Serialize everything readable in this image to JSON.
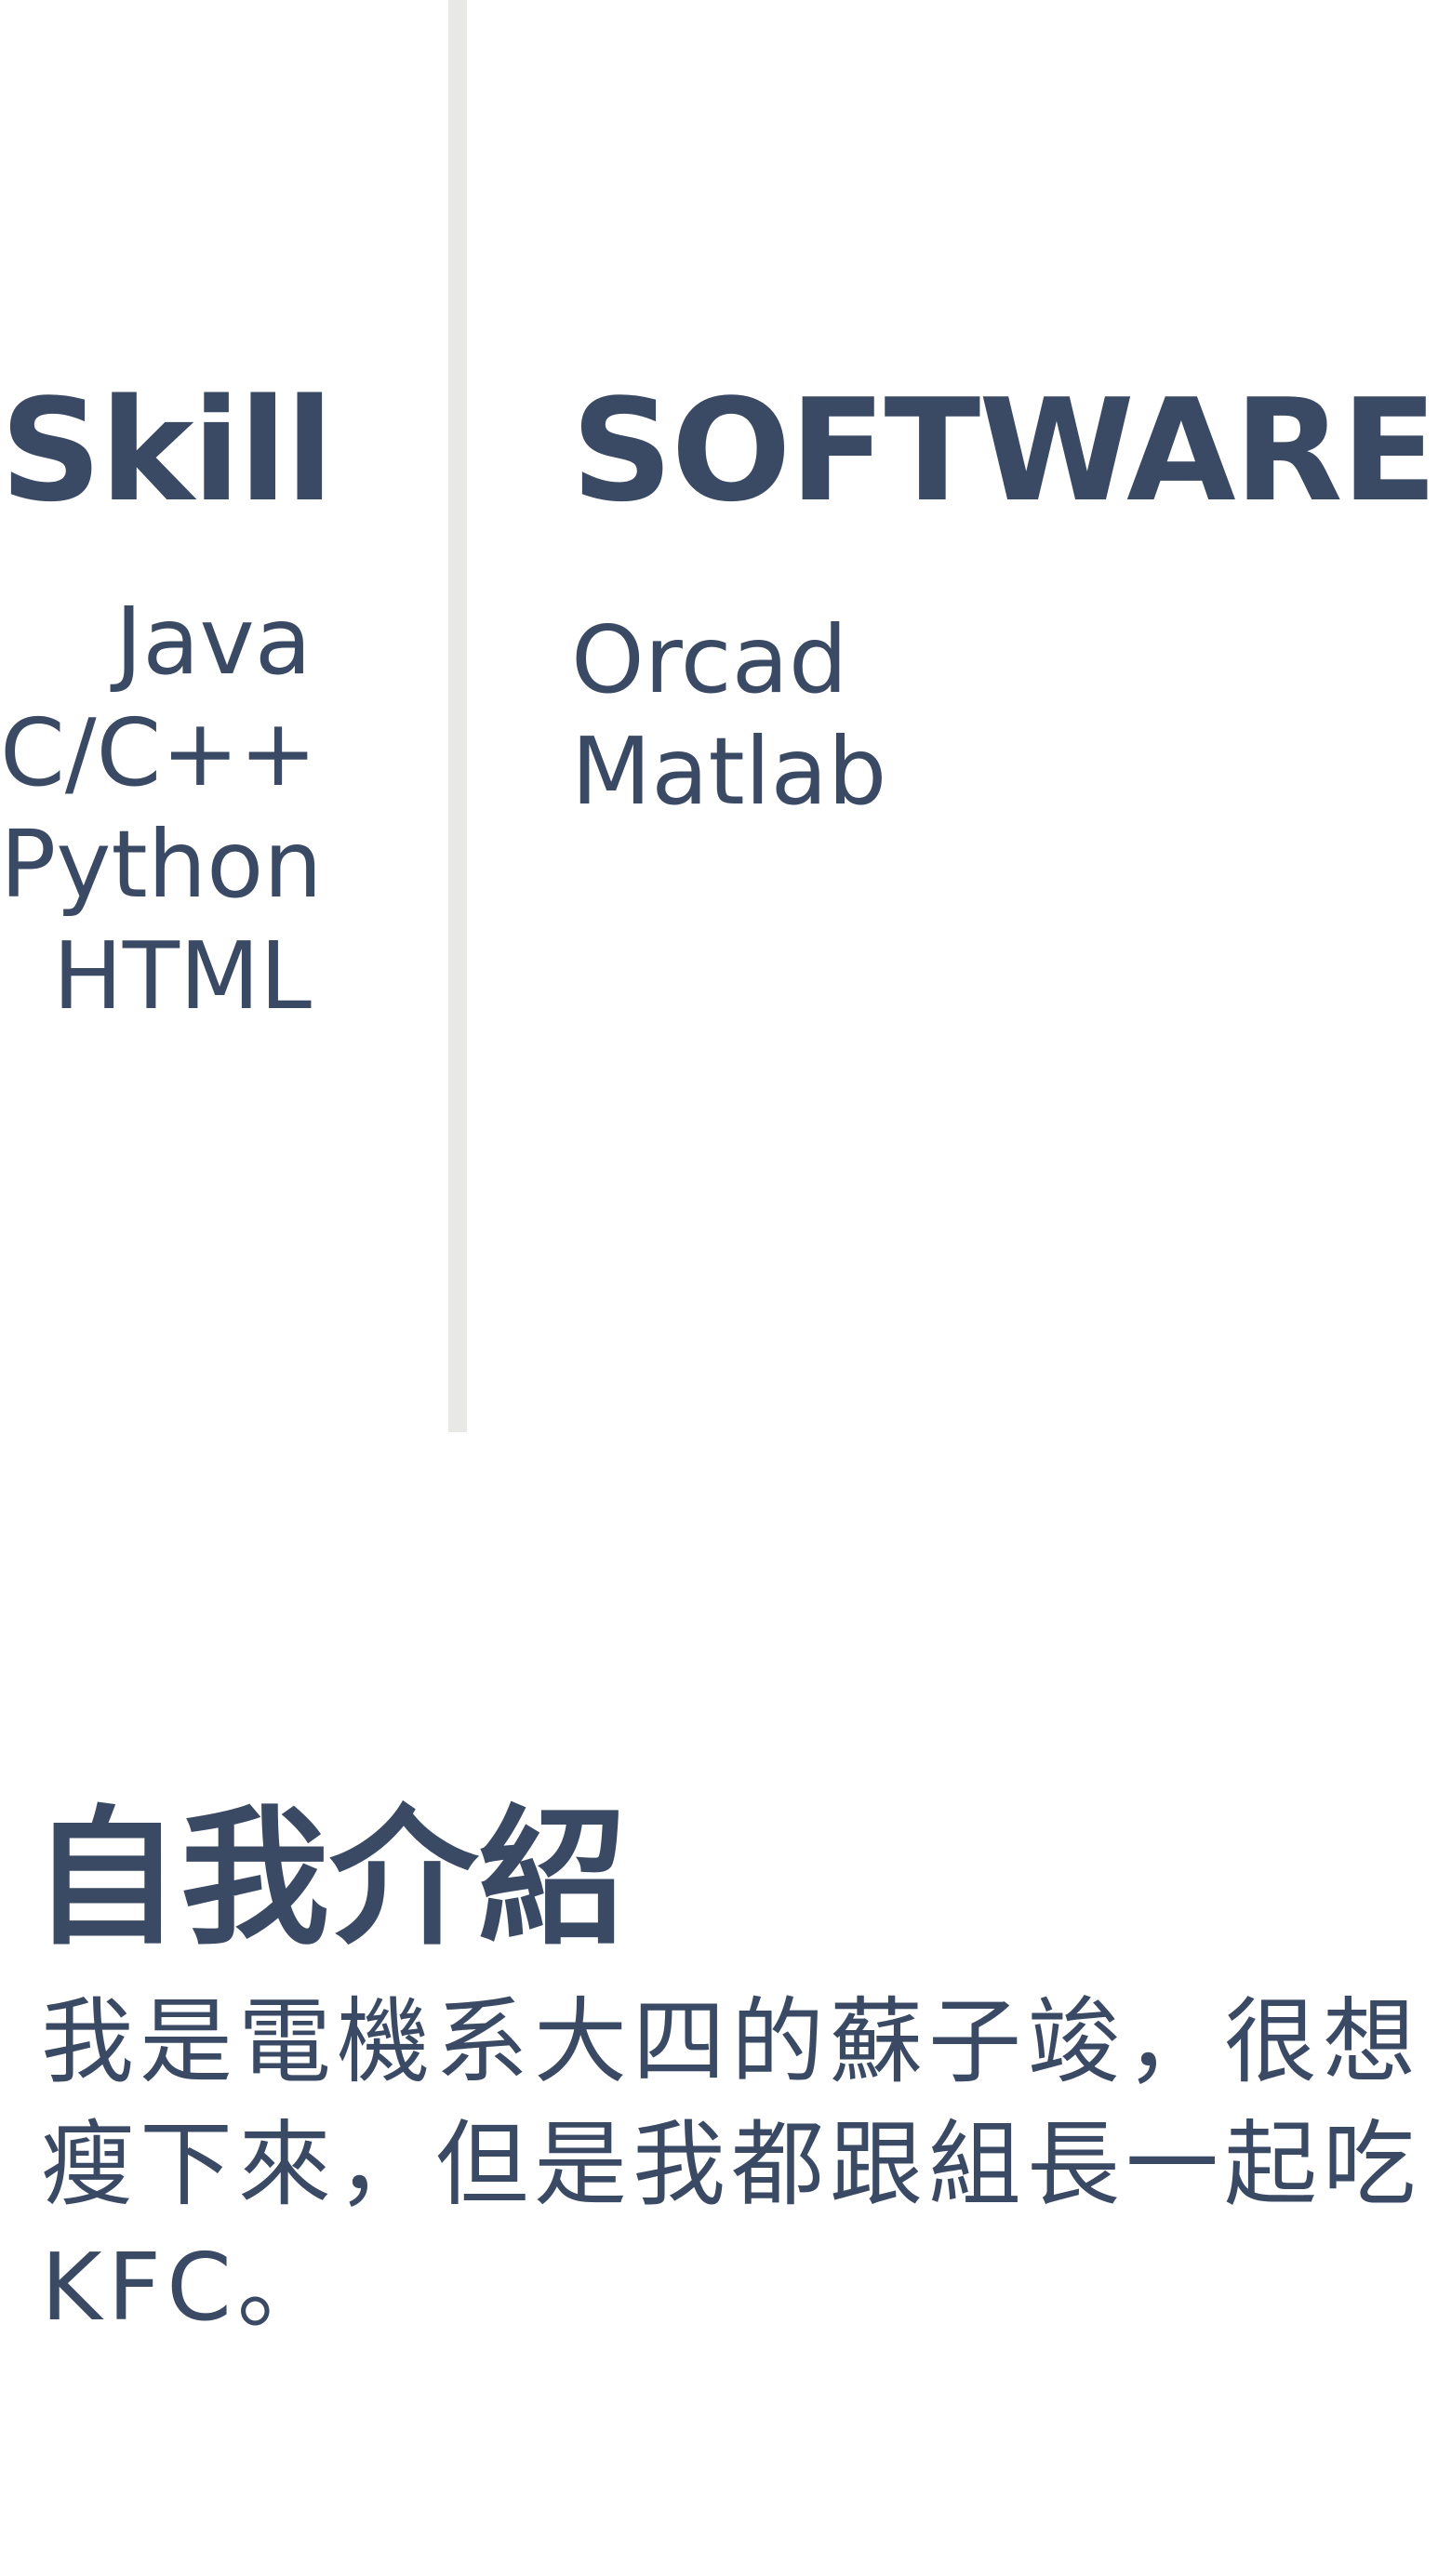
{
  "skill": {
    "title": "Skill",
    "items": [
      "Java",
      "C/C++",
      "Python",
      "HTML"
    ]
  },
  "software": {
    "title": "SOFTWARE",
    "items": [
      "Orcad",
      "Matlab"
    ]
  },
  "intro": {
    "title": "自我介紹",
    "text": "我是電機系大四的蘇子竣，很想瘦下來，但是我都跟組長一起吃KFC。"
  },
  "colors": {
    "text": "#3b4a64",
    "divider": "#e8e8e6",
    "background": "#ffffff"
  }
}
